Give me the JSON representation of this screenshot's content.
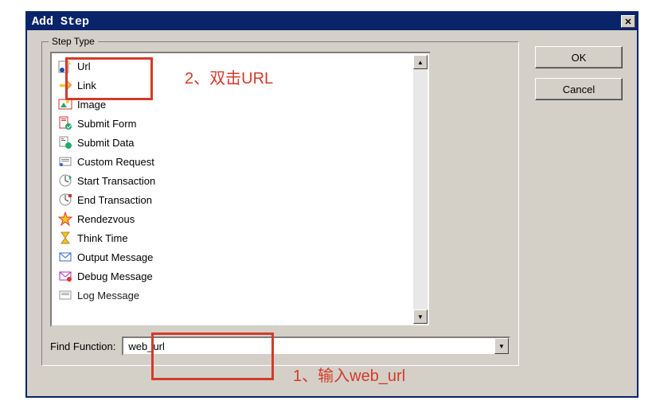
{
  "dialog": {
    "title": "Add Step",
    "ok_label": "OK",
    "cancel_label": "Cancel"
  },
  "fieldset": {
    "legend": "Step Type"
  },
  "find": {
    "label": "Find Function:",
    "value": "web_url"
  },
  "items": [
    {
      "label": "Url",
      "icon": "url-icon"
    },
    {
      "label": "Link",
      "icon": "link-icon"
    },
    {
      "label": "Image",
      "icon": "image-icon"
    },
    {
      "label": "Submit Form",
      "icon": "submit-form-icon"
    },
    {
      "label": "Submit Data",
      "icon": "submit-data-icon"
    },
    {
      "label": "Custom Request",
      "icon": "custom-request-icon"
    },
    {
      "label": "Start Transaction",
      "icon": "start-transaction-icon"
    },
    {
      "label": "End Transaction",
      "icon": "end-transaction-icon"
    },
    {
      "label": "Rendezvous",
      "icon": "rendezvous-icon"
    },
    {
      "label": "Think Time",
      "icon": "think-time-icon"
    },
    {
      "label": "Output Message",
      "icon": "output-message-icon"
    },
    {
      "label": "Debug Message",
      "icon": "debug-message-icon"
    },
    {
      "label": "Log Message",
      "icon": "log-message-icon"
    }
  ],
  "annotations": {
    "a1": "1、输入web_url",
    "a2": "2、双击URL"
  }
}
